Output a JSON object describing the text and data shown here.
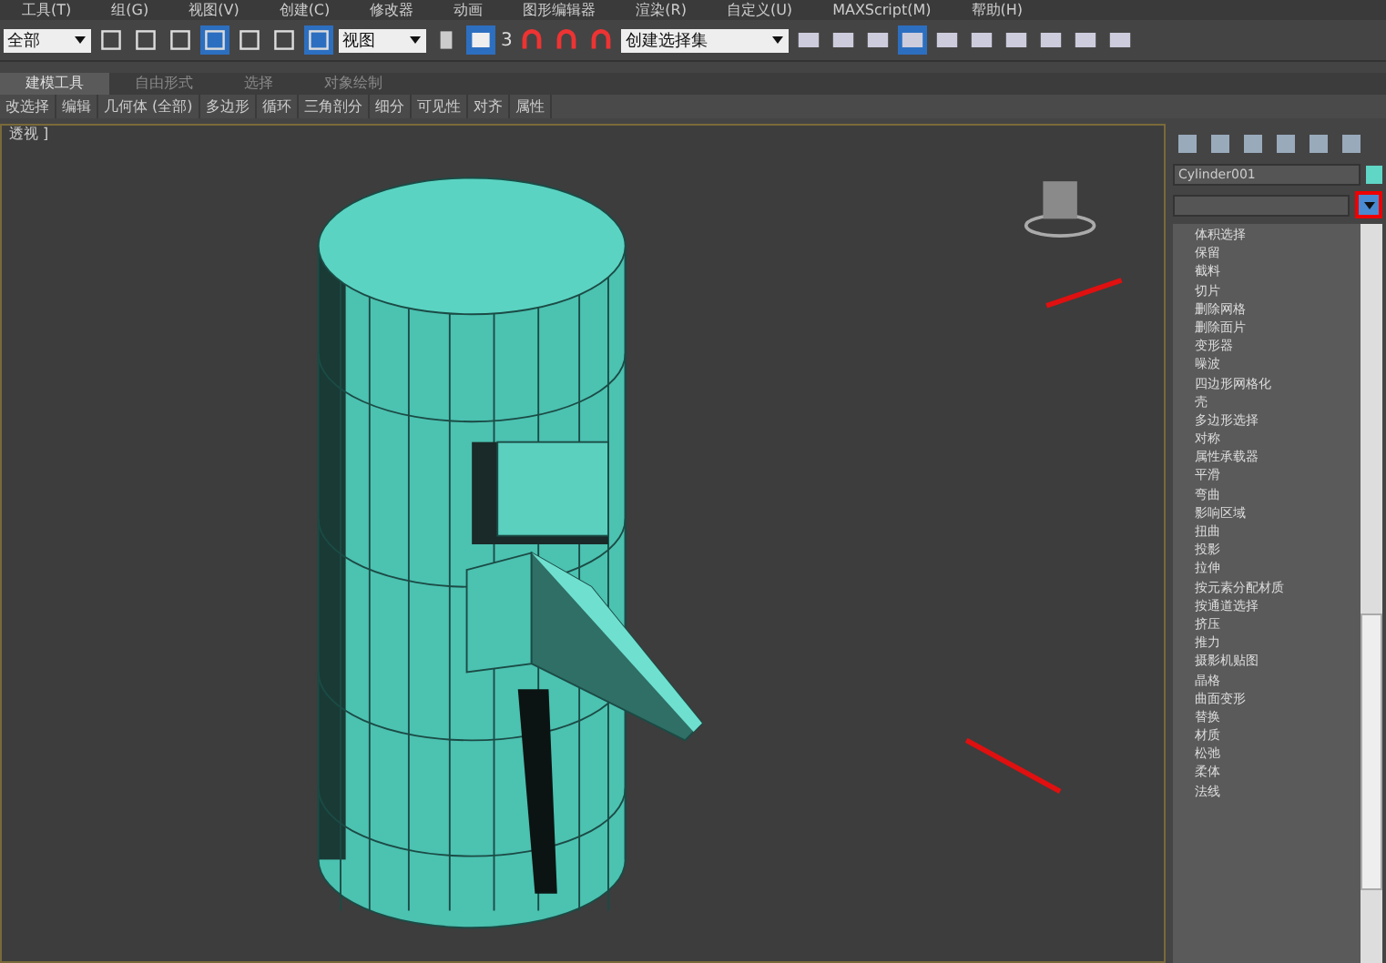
{
  "menu_bar": {
    "items": [
      "工具(T)",
      "组(G)",
      "视图(V)",
      "创建(C)",
      "修改器",
      "动画",
      "图形编辑器",
      "渲染(R)",
      "自定义(U)",
      "MAXScript(M)",
      "帮助(H)"
    ]
  },
  "toolbar": {
    "selection_filter": "全部",
    "reference_coord": "视图",
    "snap_label": "3",
    "named_selection": "创建选择集"
  },
  "ribbon": {
    "tabs": [
      {
        "label": "建模工具",
        "selected": true
      },
      {
        "label": "自由形式",
        "selected": false
      },
      {
        "label": "选择",
        "selected": false
      },
      {
        "label": "对象绘制",
        "selected": false
      }
    ],
    "buttons": [
      "改选择",
      "编辑",
      "几何体 (全部)",
      "多边形",
      "循环",
      "三角剖分",
      "细分",
      "可见性",
      "对齐",
      "属性"
    ]
  },
  "viewport": {
    "label": "透视 ]"
  },
  "command_panel": {
    "object_name": "Cylinder001",
    "modifier_list": {
      "expanded": true,
      "items": [
        "体积选择",
        "保留",
        "截料",
        "切片",
        "删除网格",
        "删除面片",
        "变形器",
        "噪波",
        "四边形网格化",
        "壳",
        "多边形选择",
        "对称",
        "属性承载器",
        "平滑",
        "弯曲",
        "影响区域",
        "扭曲",
        "投影",
        "拉伸",
        "按元素分配材质",
        "按通道选择",
        "挤压",
        "推力",
        "摄影机贴图",
        "晶格",
        "曲面变形",
        "替换",
        "材质",
        "松弛",
        "柔体",
        "法线"
      ]
    }
  }
}
